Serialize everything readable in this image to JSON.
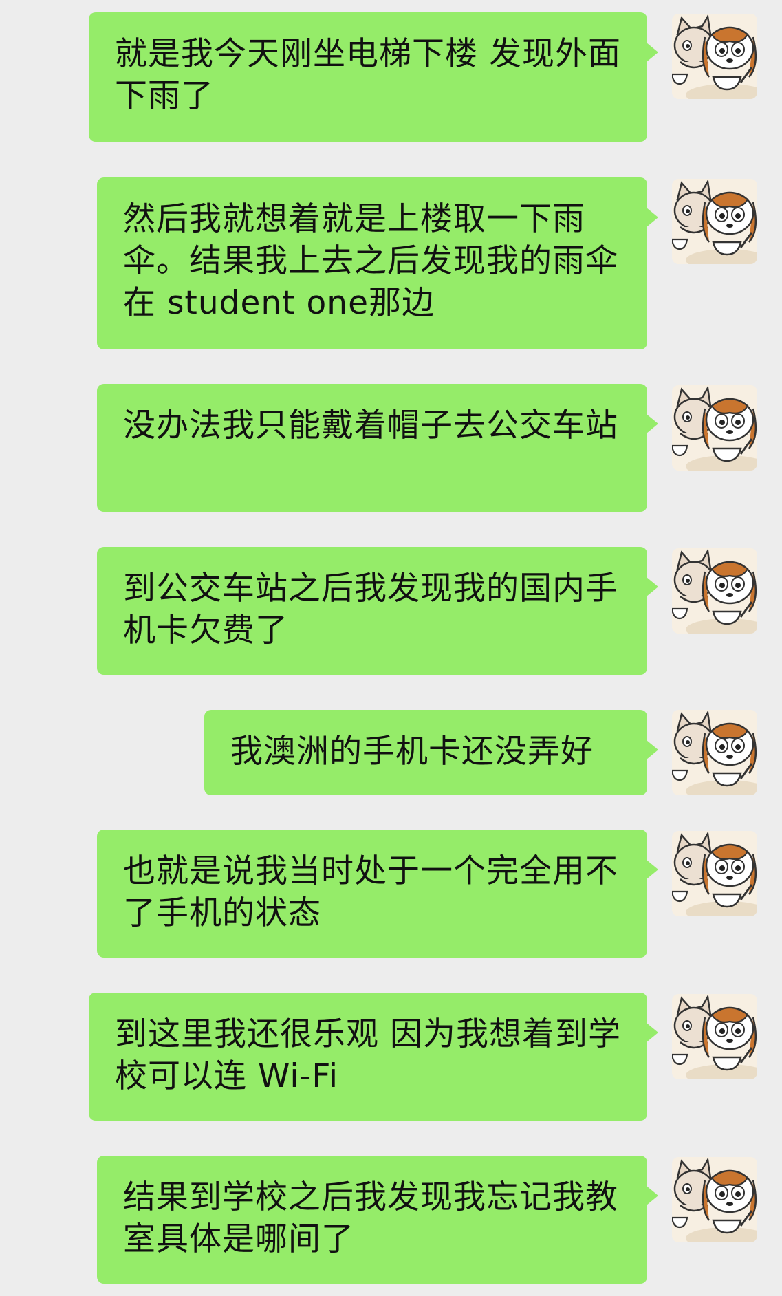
{
  "chat": {
    "messages": [
      {
        "text": "就是我今天刚坐电梯下楼 发现外面下雨了"
      },
      {
        "text": "然后我就想着就是上楼取一下雨伞。结果我上去之后发现我的雨伞在 student one那边"
      },
      {
        "text": "没办法我只能戴着帽子去公交车站"
      },
      {
        "text": "到公交车站之后我发现我的国内手机卡欠费了"
      },
      {
        "text": "我澳洲的手机卡还没弄好"
      },
      {
        "text": "也就是说我当时处于一个完全用不了手机的状态"
      },
      {
        "text": "到这里我还很乐观 因为我想着到学校可以连 Wi-Fi"
      },
      {
        "text": "结果到学校之后我发现我忘记我教室具体是哪间了"
      }
    ]
  },
  "colors": {
    "background": "#ededed",
    "bubble": "#95ec69",
    "text": "#111111"
  },
  "icons": {
    "avatar": "cartoon-cat-and-dog-avatar-icon"
  }
}
